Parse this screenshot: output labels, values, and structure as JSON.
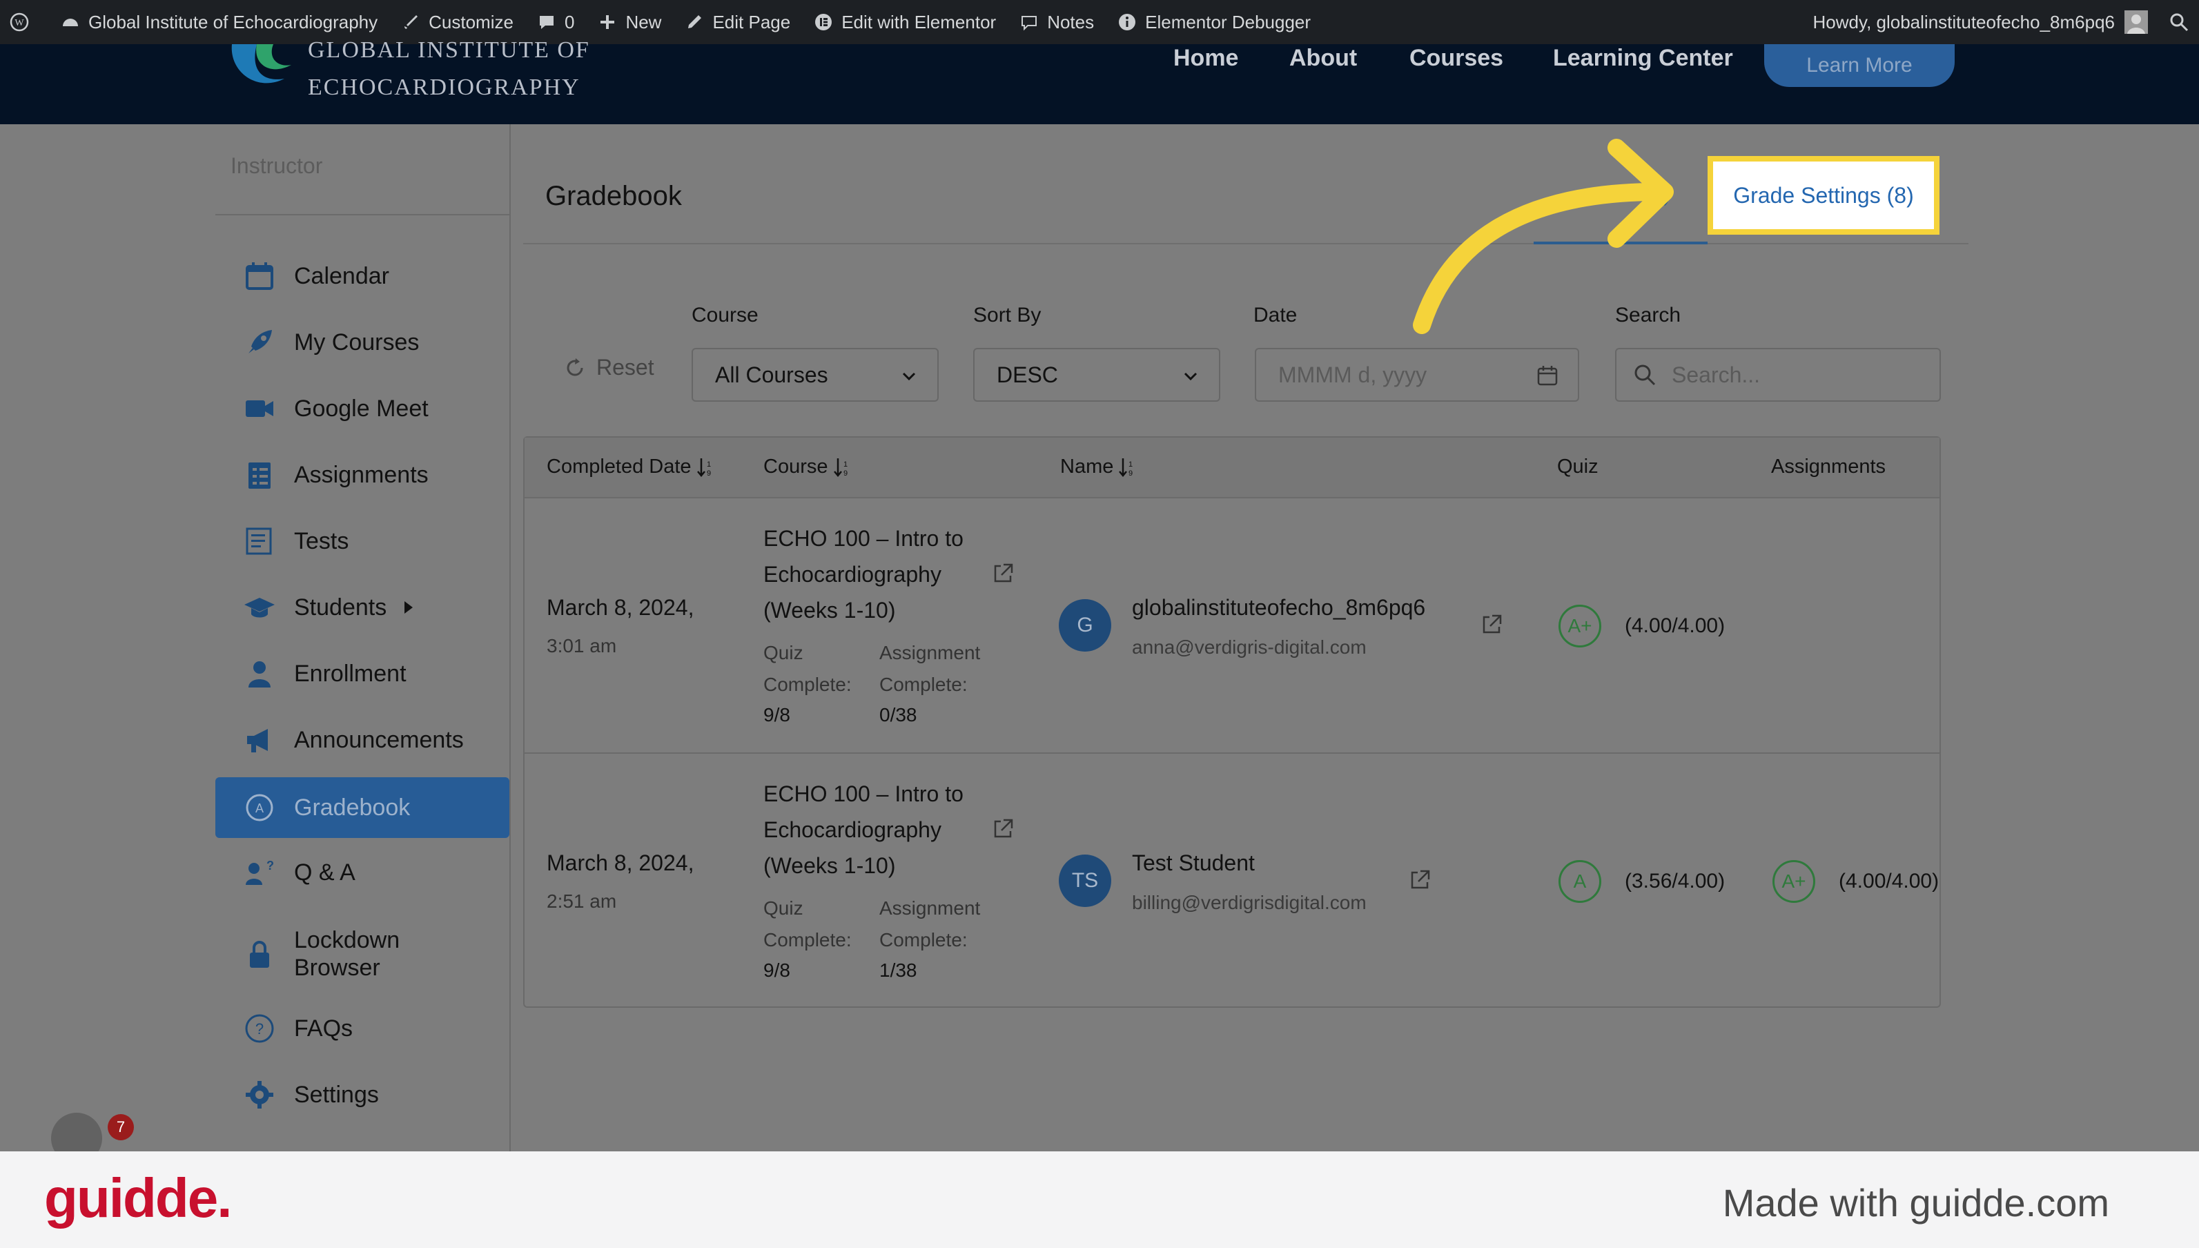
{
  "wp_bar": {
    "site_name": "Global Institute of Echocardiography",
    "customize": "Customize",
    "comments_count": "0",
    "new": "New",
    "edit_page": "Edit Page",
    "edit_elementor": "Edit with Elementor",
    "notes": "Notes",
    "debugger": "Elementor Debugger",
    "howdy": "Howdy, globalinstituteofecho_8m6pq6"
  },
  "site_header": {
    "logo_line1": "GLOBAL INSTITUTE OF",
    "logo_line2": "ECHOCARDIOGRAPHY",
    "nav": [
      "Home",
      "About",
      "Courses",
      "Learning Center"
    ],
    "cta": "Learn More"
  },
  "sidebar": {
    "section_label": "Instructor",
    "items": [
      {
        "label": "Calendar",
        "icon": "calendar-icon"
      },
      {
        "label": "My Courses",
        "icon": "rocket-icon"
      },
      {
        "label": "Google Meet",
        "icon": "video-icon"
      },
      {
        "label": "Assignments",
        "icon": "assignment-icon"
      },
      {
        "label": "Tests",
        "icon": "tests-icon"
      },
      {
        "label": "Students",
        "icon": "graduation-cap-icon"
      },
      {
        "label": "Enrollment",
        "icon": "user-icon"
      },
      {
        "label": "Announcements",
        "icon": "megaphone-icon"
      },
      {
        "label": "Gradebook",
        "icon": "gradebook-icon",
        "active": true
      },
      {
        "label": "Q & A",
        "icon": "qa-icon"
      },
      {
        "label": "Lockdown\nBrowser",
        "icon": "lock-icon"
      },
      {
        "label": "FAQs",
        "icon": "question-icon"
      },
      {
        "label": "Settings",
        "icon": "gear-icon"
      }
    ]
  },
  "gradebook": {
    "title": "Gradebook",
    "tab_partial": ")",
    "grade_settings_tab": "Grade Settings (8)",
    "filters": {
      "reset": "Reset",
      "course_label": "Course",
      "course_value": "All Courses",
      "sort_label": "Sort By",
      "sort_value": "DESC",
      "date_label": "Date",
      "date_placeholder": "MMMM d, yyyy",
      "search_label": "Search",
      "search_placeholder": "Search..."
    },
    "columns": [
      "Completed Date",
      "Course",
      "Name",
      "Quiz",
      "Assignments"
    ],
    "rows": [
      {
        "date": "March 8, 2024,",
        "time": "3:01 am",
        "course_l1": "ECHO 100 – Intro to",
        "course_l2": "Echocardiography",
        "course_l3": "(Weeks 1-10)",
        "quiz_label1": "Quiz",
        "quiz_label2": "Complete:",
        "quiz_value": "9/8",
        "assign_label1": "Assignment",
        "assign_label2": "Complete:",
        "assign_value": "0/38",
        "avatar": "G",
        "name": "globalinstituteofecho_8m6pq6",
        "email": "anna@verdigris-digital.com",
        "quiz_grade": "A+",
        "quiz_score": "(4.00/4.00)"
      },
      {
        "date": "March 8, 2024,",
        "time": "2:51 am",
        "course_l1": "ECHO 100 – Intro to",
        "course_l2": "Echocardiography",
        "course_l3": "(Weeks 1-10)",
        "quiz_label1": "Quiz",
        "quiz_label2": "Complete:",
        "quiz_value": "9/8",
        "assign_label1": "Assignment",
        "assign_label2": "Complete:",
        "assign_value": "1/38",
        "avatar": "TS",
        "name": "Test Student",
        "email": "billing@verdigrisdigital.com",
        "quiz_grade": "A",
        "quiz_score": "(3.56/4.00)",
        "assign_grade": "A+",
        "assign_score": "(4.00/4.00)"
      }
    ]
  },
  "footer": {
    "logo": "guidde.",
    "made_with": "Made with guidde.com",
    "notification_count": "7"
  },
  "colors": {
    "accent": "#2467b0",
    "highlight": "#f5d33a",
    "active_sidebar": "#275c96",
    "grade_green": "#2f7a3c",
    "brand_red": "#c8102e"
  }
}
